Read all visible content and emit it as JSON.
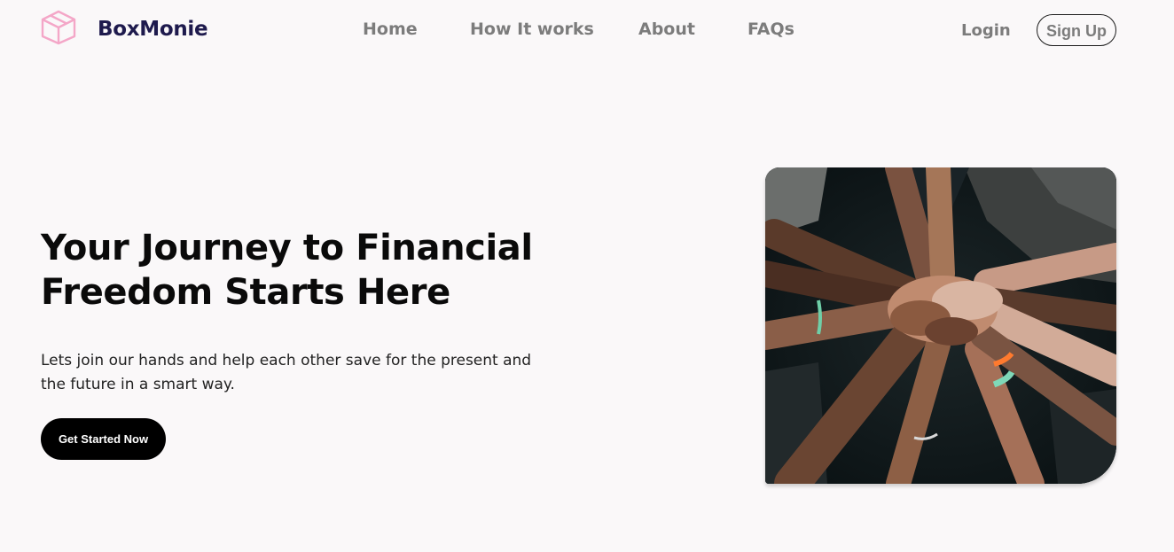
{
  "brand": {
    "name": "BoxMonie",
    "logo_icon": "cube-icon",
    "logo_color": "#f4a7c8"
  },
  "nav": {
    "links": [
      "Home",
      "How It works",
      "About",
      "FAQs"
    ],
    "login": "Login",
    "signup": "Sign Up"
  },
  "hero": {
    "title_line1": "Your Journey to Financial",
    "title_line2": "Freedom Starts Here",
    "text_line1": "Lets join our hands and help each other save for the present and",
    "text_line2": "the future in a smart way.",
    "cta": "Get Started Now",
    "image": "stacked-hands-photo"
  },
  "colors": {
    "background": "#faf8f9",
    "brand_text": "#1e1a4d",
    "nav_text": "#7c7c7c",
    "cta_background": "#000000"
  }
}
